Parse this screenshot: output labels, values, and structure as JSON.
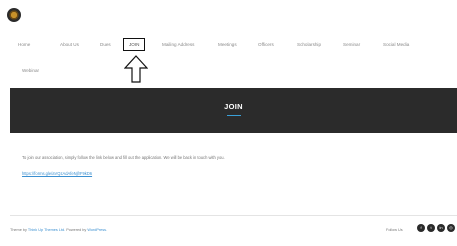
{
  "nav": {
    "items": [
      "Home",
      "About Us",
      "Dues",
      "JOIN",
      "Mailing Address",
      "Meetings",
      "Officers",
      "Scholarship",
      "Seminar",
      "Social Media"
    ],
    "second_row": [
      "Webinar"
    ]
  },
  "hero": {
    "title": "JOIN"
  },
  "content": {
    "text": "To join our association, simply follow the link below and fill out the application. We will be back in touch with you.",
    "link": "https://forms.gle/aVQzAdAfeNjfrF9kD6"
  },
  "footer": {
    "theme_prefix": "Theme by",
    "theme_link": "Think Up Themes Ltd.",
    "powered_prefix": "Powered by",
    "powered_link": "WordPress.",
    "follow_label": "Follow Us"
  },
  "social_icons": [
    "facebook-icon",
    "twitter-icon",
    "linkedin-icon",
    "instagram-icon"
  ]
}
